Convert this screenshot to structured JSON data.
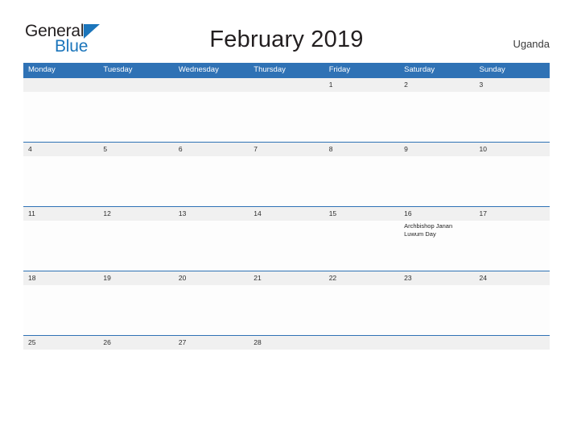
{
  "brand": {
    "name_part1": "General",
    "name_part2": "Blue",
    "logo_icon": "blue-triangle-logo"
  },
  "header": {
    "title": "February 2019",
    "country": "Uganda"
  },
  "calendar": {
    "weekdays": [
      "Monday",
      "Tuesday",
      "Wednesday",
      "Thursday",
      "Friday",
      "Saturday",
      "Sunday"
    ],
    "month": "February",
    "year": "2019",
    "weeks": [
      [
        {
          "date": "",
          "event": ""
        },
        {
          "date": "",
          "event": ""
        },
        {
          "date": "",
          "event": ""
        },
        {
          "date": "",
          "event": ""
        },
        {
          "date": "1",
          "event": ""
        },
        {
          "date": "2",
          "event": ""
        },
        {
          "date": "3",
          "event": ""
        }
      ],
      [
        {
          "date": "4",
          "event": ""
        },
        {
          "date": "5",
          "event": ""
        },
        {
          "date": "6",
          "event": ""
        },
        {
          "date": "7",
          "event": ""
        },
        {
          "date": "8",
          "event": ""
        },
        {
          "date": "9",
          "event": ""
        },
        {
          "date": "10",
          "event": ""
        }
      ],
      [
        {
          "date": "11",
          "event": ""
        },
        {
          "date": "12",
          "event": ""
        },
        {
          "date": "13",
          "event": ""
        },
        {
          "date": "14",
          "event": ""
        },
        {
          "date": "15",
          "event": ""
        },
        {
          "date": "16",
          "event": "Archbishop Janan Luwum Day"
        },
        {
          "date": "17",
          "event": ""
        }
      ],
      [
        {
          "date": "18",
          "event": ""
        },
        {
          "date": "19",
          "event": ""
        },
        {
          "date": "20",
          "event": ""
        },
        {
          "date": "21",
          "event": ""
        },
        {
          "date": "22",
          "event": ""
        },
        {
          "date": "23",
          "event": ""
        },
        {
          "date": "24",
          "event": ""
        }
      ],
      [
        {
          "date": "25",
          "event": ""
        },
        {
          "date": "26",
          "event": ""
        },
        {
          "date": "27",
          "event": ""
        },
        {
          "date": "28",
          "event": ""
        },
        {
          "date": "",
          "event": ""
        },
        {
          "date": "",
          "event": ""
        },
        {
          "date": "",
          "event": ""
        }
      ]
    ]
  },
  "colors": {
    "header_blue": "#2f72b5",
    "brand_blue": "#1b75bb",
    "day_band_gray": "#f0f0f0",
    "text_dark": "#231f20"
  }
}
